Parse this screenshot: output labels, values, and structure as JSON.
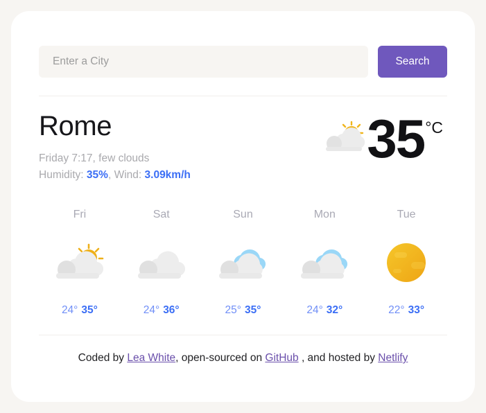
{
  "theme": {
    "page_background": "#f7f5f2",
    "card_background": "#ffffff",
    "accent_purple": "#6f58bd",
    "accent_blue": "#3b6ef5",
    "muted_text": "#a9a9ad",
    "link_purple": "#6a4fab",
    "sun_yellow": "#f0b51c",
    "cloud_gray": "#e6e6e6",
    "cloud_blue": "#8fd2f5"
  },
  "search": {
    "placeholder": "Enter a City",
    "value": "",
    "button_label": "Search"
  },
  "current": {
    "city": "Rome",
    "condition_line": "Friday 7:17, few clouds",
    "humidity_label": "Humidity:",
    "humidity_value": "35%",
    "separator": ", ",
    "wind_label": "Wind:",
    "wind_value": "3.09km/h",
    "temperature": "35",
    "unit": "°C",
    "icon": "sun-behind-cloud-icon"
  },
  "forecast": [
    {
      "day": "Fri",
      "icon": "sun-behind-cloud-icon",
      "min": "24°",
      "max": "35°"
    },
    {
      "day": "Sat",
      "icon": "cloud-icon",
      "min": "24°",
      "max": "36°"
    },
    {
      "day": "Sun",
      "icon": "blue-cloud-icon",
      "min": "25°",
      "max": "35°"
    },
    {
      "day": "Mon",
      "icon": "blue-cloud-icon",
      "min": "24°",
      "max": "32°"
    },
    {
      "day": "Tue",
      "icon": "sun-icon",
      "min": "22°",
      "max": "33°"
    }
  ],
  "footer": {
    "prefix": "Coded by ",
    "author": "Lea White",
    "middle": ", open-sourced on ",
    "repo": "GitHub",
    "middle2": " , and hosted by ",
    "host": "Netlify"
  }
}
